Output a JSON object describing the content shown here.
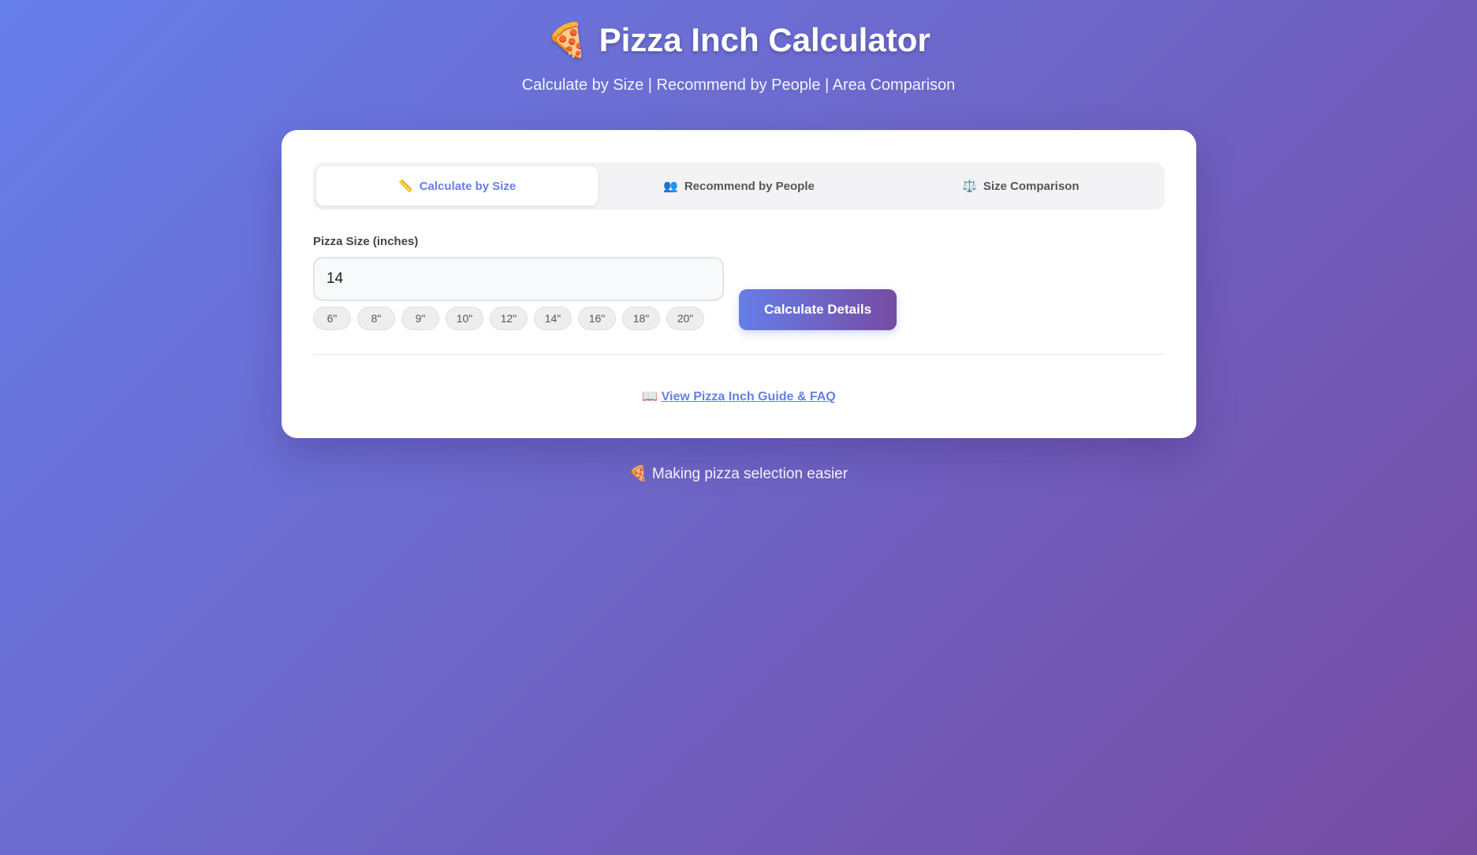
{
  "header": {
    "title_icon": "🍕",
    "title": "Pizza Inch Calculator",
    "subtitle": "Calculate by Size | Recommend by People | Area Comparison"
  },
  "tabs": [
    {
      "icon": "📏",
      "label": "Calculate by Size",
      "active": true
    },
    {
      "icon": "👥",
      "label": "Recommend by People",
      "active": false
    },
    {
      "icon": "⚖️",
      "label": "Size Comparison",
      "active": false
    }
  ],
  "form": {
    "label": "Pizza Size (inches)",
    "value": "14",
    "presets": [
      "6\"",
      "8\"",
      "9\"",
      "10\"",
      "12\"",
      "14\"",
      "16\"",
      "18\"",
      "20\""
    ],
    "button_label": "Calculate Details"
  },
  "guide": {
    "icon": "📖",
    "label": "View Pizza Inch Guide & FAQ"
  },
  "footer": {
    "icon": "🍕",
    "text": "Making pizza selection easier"
  },
  "colors": {
    "accent": "#667eea",
    "accent_end": "#764ba2"
  }
}
